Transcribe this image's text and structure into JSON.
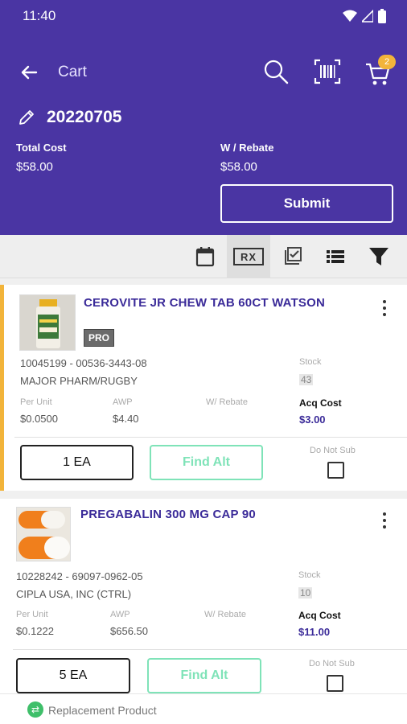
{
  "status": {
    "time": "11:40"
  },
  "header": {
    "title": "Cart",
    "cart_badge": "2",
    "order_number": "20220705",
    "total_cost_label": "Total Cost",
    "total_cost_value": "$58.00",
    "rebate_label": "W / Rebate",
    "rebate_value": "$58.00",
    "submit_label": "Submit"
  },
  "toolbar": {
    "rx_label": "RX"
  },
  "products": [
    {
      "name": "CEROVITE JR CHEW TAB 60CT WATSON",
      "badge": "PRO",
      "ids": "10045199 - 00536-3443-08",
      "manufacturer": "MAJOR PHARM/RUGBY",
      "stock_label": "Stock",
      "stock_value": "43",
      "per_unit_label": "Per Unit",
      "per_unit_value": "$0.0500",
      "awp_label": "AWP",
      "awp_value": "$4.40",
      "rebate_label": "W/ Rebate",
      "acq_label": "Acq Cost",
      "acq_value": "$3.00",
      "qty": "1 EA",
      "find_alt": "Find Alt",
      "do_not_sub": "Do Not Sub"
    },
    {
      "name": "PREGABALIN 300 MG CAP 90",
      "ids": "10228242 - 69097-0962-05",
      "manufacturer": "CIPLA USA, INC (CTRL)",
      "stock_label": "Stock",
      "stock_value": "10",
      "per_unit_label": "Per Unit",
      "per_unit_value": "$0.1222",
      "awp_label": "AWP",
      "awp_value": "$656.50",
      "rebate_label": "W/ Rebate",
      "acq_label": "Acq Cost",
      "acq_value": "$11.00",
      "qty": "5 EA",
      "find_alt": "Find Alt",
      "do_not_sub": "Do Not Sub"
    }
  ],
  "replacement": {
    "label": "Replacement Product"
  },
  "colors": {
    "header_bg": "#4a35a3",
    "accent": "#f2b43a",
    "alt_green": "#7fe3b8",
    "name_purple": "#3b2b99"
  },
  "icons": [
    "back-arrow-icon",
    "search-icon",
    "barcode-scan-icon",
    "cart-icon",
    "pencil-icon",
    "calendar-icon",
    "checklist-icon",
    "list-icon",
    "filter-icon",
    "more-vertical-icon",
    "swap-icon"
  ]
}
